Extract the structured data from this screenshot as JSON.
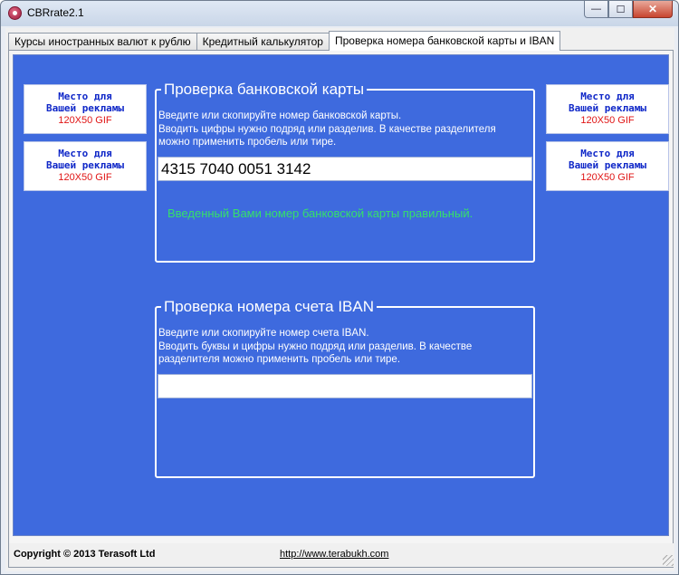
{
  "window": {
    "title": "CBRrate2.1",
    "minimize_glyph": "—",
    "maximize_glyph": "☐",
    "close_glyph": "✕"
  },
  "tabs": [
    {
      "label": "Курсы иностранных валют к рублю"
    },
    {
      "label": "Кредитный калькулятор"
    },
    {
      "label": "Проверка номера банковской карты и IBAN"
    }
  ],
  "ads": {
    "line1": "Место для",
    "line2": "Вашей рекламы",
    "line3": "120X50 GIF"
  },
  "card_check": {
    "legend": "Проверка банковской карты",
    "hint_line1": "Введите или скопируйте номер банковской карты.",
    "hint_line2": "Вводить цифры нужно подряд или разделив. В качестве разделителя",
    "hint_line3": "можно применить пробель или тире.",
    "value": "4315 7040 0051 3142",
    "result": "Введенный Вами номер банковской карты правильный."
  },
  "iban_check": {
    "legend": "Проверка номера счета IBAN",
    "hint_line1": "Введите или скопируйте номер счета IBAN.",
    "hint_line2": "Вводить буквы и цифры нужно подряд или разделив. В качестве",
    "hint_line3": "разделителя можно применить пробель или тире.",
    "value": ""
  },
  "footer": {
    "copyright": "Copyright © 2013 Terasoft Ltd",
    "link": "http://www.terabukh.com"
  },
  "colors": {
    "panel_blue": "#3e6ade",
    "ad_text": "#1028c8",
    "ad_size": "#e01414",
    "ok_text": "#35e06a"
  }
}
